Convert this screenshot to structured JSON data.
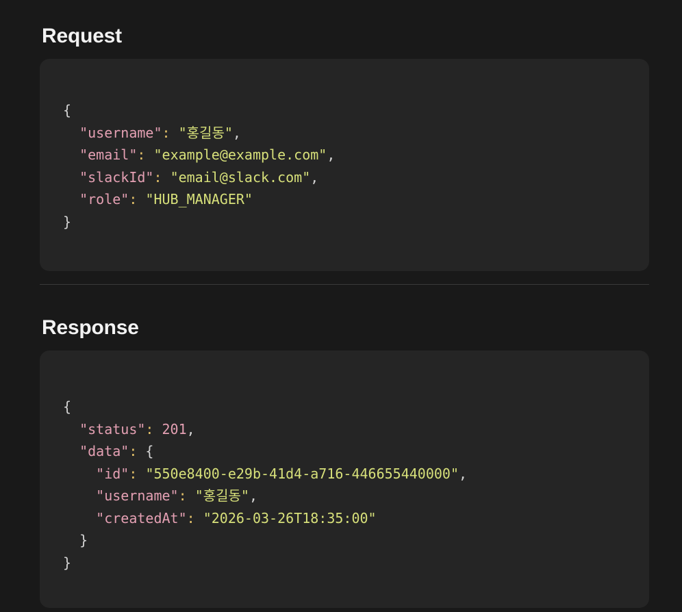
{
  "request": {
    "title": "Request",
    "lines": [
      {
        "parts": [
          {
            "t": "{",
            "c": "punc"
          }
        ]
      },
      {
        "parts": [
          {
            "t": "  ",
            "c": "punc"
          },
          {
            "t": "\"username\"",
            "c": "key"
          },
          {
            "t": ":",
            "c": "colon"
          },
          {
            "t": " ",
            "c": "punc"
          },
          {
            "t": "\"홍길동\"",
            "c": "str"
          },
          {
            "t": ",",
            "c": "punc"
          }
        ]
      },
      {
        "parts": [
          {
            "t": "  ",
            "c": "punc"
          },
          {
            "t": "\"email\"",
            "c": "key"
          },
          {
            "t": ":",
            "c": "colon"
          },
          {
            "t": " ",
            "c": "punc"
          },
          {
            "t": "\"example@example.com\"",
            "c": "str"
          },
          {
            "t": ",",
            "c": "punc"
          }
        ]
      },
      {
        "parts": [
          {
            "t": "  ",
            "c": "punc"
          },
          {
            "t": "\"slackId\"",
            "c": "key"
          },
          {
            "t": ":",
            "c": "colon"
          },
          {
            "t": " ",
            "c": "punc"
          },
          {
            "t": "\"email@slack.com\"",
            "c": "str"
          },
          {
            "t": ",",
            "c": "punc"
          }
        ]
      },
      {
        "parts": [
          {
            "t": "  ",
            "c": "punc"
          },
          {
            "t": "\"role\"",
            "c": "key"
          },
          {
            "t": ":",
            "c": "colon"
          },
          {
            "t": " ",
            "c": "punc"
          },
          {
            "t": "\"HUB_MANAGER\"",
            "c": "str"
          }
        ]
      },
      {
        "parts": [
          {
            "t": "}",
            "c": "punc"
          }
        ]
      }
    ]
  },
  "response": {
    "title": "Response",
    "lines": [
      {
        "parts": [
          {
            "t": "{",
            "c": "punc"
          }
        ]
      },
      {
        "parts": [
          {
            "t": "  ",
            "c": "punc"
          },
          {
            "t": "\"status\"",
            "c": "key"
          },
          {
            "t": ":",
            "c": "colon"
          },
          {
            "t": " ",
            "c": "punc"
          },
          {
            "t": "201",
            "c": "num"
          },
          {
            "t": ",",
            "c": "punc"
          }
        ]
      },
      {
        "parts": [
          {
            "t": "  ",
            "c": "punc"
          },
          {
            "t": "\"data\"",
            "c": "key"
          },
          {
            "t": ":",
            "c": "colon"
          },
          {
            "t": " {",
            "c": "punc"
          }
        ]
      },
      {
        "parts": [
          {
            "t": "    ",
            "c": "punc"
          },
          {
            "t": "\"id\"",
            "c": "key"
          },
          {
            "t": ":",
            "c": "colon"
          },
          {
            "t": " ",
            "c": "punc"
          },
          {
            "t": "\"550e8400-e29b-41d4-a716-446655440000\"",
            "c": "str"
          },
          {
            "t": ",",
            "c": "punc"
          }
        ]
      },
      {
        "parts": [
          {
            "t": "    ",
            "c": "punc"
          },
          {
            "t": "\"username\"",
            "c": "key"
          },
          {
            "t": ":",
            "c": "colon"
          },
          {
            "t": " ",
            "c": "punc"
          },
          {
            "t": "\"홍길동\"",
            "c": "str"
          },
          {
            "t": ",",
            "c": "punc"
          }
        ]
      },
      {
        "parts": [
          {
            "t": "    ",
            "c": "punc"
          },
          {
            "t": "\"createdAt\"",
            "c": "key"
          },
          {
            "t": ":",
            "c": "colon"
          },
          {
            "t": " ",
            "c": "punc"
          },
          {
            "t": "\"2026-03-26T18:35:00\"",
            "c": "str"
          }
        ]
      },
      {
        "parts": [
          {
            "t": "  }",
            "c": "punc"
          }
        ]
      },
      {
        "parts": [
          {
            "t": "}",
            "c": "punc"
          }
        ]
      }
    ]
  },
  "colors": {
    "background": "#191919",
    "code_background": "#252525",
    "key": "#e4a0b3",
    "string": "#d7e07a",
    "number": "#e4a0b3",
    "colon": "#e6c36a",
    "punctuation": "#d4d4d4"
  }
}
